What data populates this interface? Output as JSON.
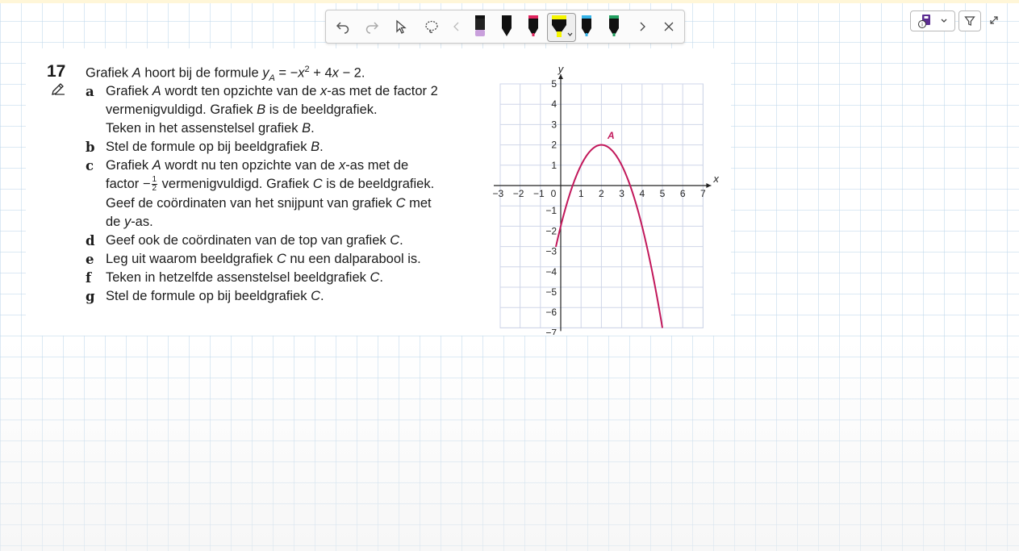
{
  "colors": {
    "accent": "#c2185b",
    "grid": "#cfd6e8",
    "axis": "#222222"
  },
  "toolbar": {
    "buttons": [
      {
        "name": "undo-icon"
      },
      {
        "name": "redo-icon"
      },
      {
        "name": "select-pointer-icon"
      },
      {
        "name": "lasso-icon"
      },
      {
        "name": "chevron-left-icon"
      }
    ],
    "pens": [
      {
        "name": "pen-purple",
        "color": "#c9a0dc"
      },
      {
        "name": "pen-black",
        "color": "#111111"
      },
      {
        "name": "pen-red",
        "color": "#e0245e"
      },
      {
        "name": "highlighter-yellow",
        "color": "#f5f500",
        "selected": true
      },
      {
        "name": "pen-cyan",
        "color": "#36b3e8"
      },
      {
        "name": "pen-green",
        "color": "#22a061"
      }
    ]
  },
  "exercise": {
    "number": "17",
    "intro": {
      "pre": "Grafiek ",
      "A": "A",
      "mid": " hoort bij de formule ",
      "y": "y",
      "sub": "A",
      "eq1": " = −",
      "x": "x",
      "sup": "2",
      "eq2": " + 4",
      "x2": "x",
      "eq3": " − 2."
    },
    "a": {
      "letter": "a",
      "l1_pre": "Grafiek ",
      "l1_A": "A",
      "l1_mid": " wordt ten opzichte van de ",
      "l1_x": "x",
      "l1_post": "-as met de factor 2",
      "l2_pre": "vermenigvuldigd. Grafiek ",
      "l2_B": "B",
      "l2_post": " is de beeldgrafiek.",
      "l3_pre": "Teken in het assenstelsel grafiek ",
      "l3_B": "B",
      "l3_post": "."
    },
    "b": {
      "letter": "b",
      "pre": "Stel de formule op bij beeldgrafiek ",
      "B": "B",
      "post": "."
    },
    "c": {
      "letter": "c",
      "l1_pre": "Grafiek ",
      "l1_A": "A",
      "l1_mid": " wordt nu ten opzichte van de ",
      "l1_x": "x",
      "l1_post": "-as met de",
      "l2_pre": "factor −",
      "frac_num": "1",
      "frac_den": "2",
      "l2_mid": " vermenigvuldigd. Grafiek ",
      "l2_C": "C",
      "l2_post": " is de beeldgrafiek.",
      "l3_pre": "Geef de coördinaten van het snijpunt van grafiek ",
      "l3_C": "C",
      "l3_post": " met",
      "l4_pre": "de ",
      "l4_y": "y",
      "l4_post": "-as."
    },
    "d": {
      "letter": "d",
      "pre": "Geef ook de coördinaten van de top van grafiek ",
      "C": "C",
      "post": "."
    },
    "e": {
      "letter": "e",
      "pre": "Leg uit waarom beeldgrafiek ",
      "C": "C",
      "post": " nu een dalparabool is."
    },
    "f": {
      "letter": "f",
      "pre": "Teken in hetzelfde assenstelsel beeldgrafiek ",
      "C": "C",
      "post": "."
    },
    "g": {
      "letter": "g",
      "pre": "Stel de formule op bij beeldgrafiek ",
      "C": "C",
      "post": "."
    }
  },
  "chart_data": {
    "type": "line",
    "xlabel": "x",
    "ylabel": "y",
    "xlim": [
      -3,
      7
    ],
    "ylim": [
      -7,
      5
    ],
    "x_ticks": [
      "−3",
      "−2",
      "−1",
      "0",
      "1",
      "2",
      "3",
      "4",
      "5",
      "6",
      "7"
    ],
    "y_ticks": [
      "5",
      "4",
      "3",
      "2",
      "1",
      "−1",
      "−2",
      "−3",
      "−4",
      "−5",
      "−6",
      "−7"
    ],
    "grid": true,
    "series": [
      {
        "name": "A",
        "formula": "y = -x^2 + 4x - 2",
        "x_range": [
          -0.24,
          5.0
        ],
        "color": "#c2185b"
      }
    ]
  }
}
